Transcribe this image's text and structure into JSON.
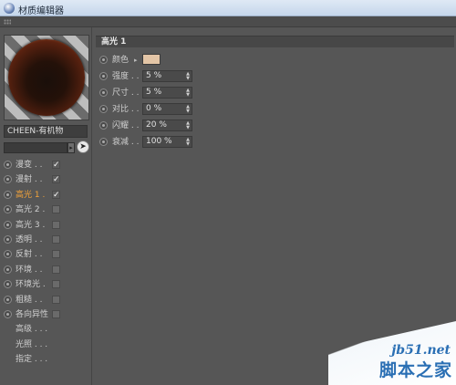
{
  "window": {
    "title": "材质编辑器"
  },
  "material": {
    "name": "CHEEN-有机物",
    "filter_value": ""
  },
  "channels": [
    {
      "label": "漫变 . .",
      "checked": true,
      "active": false
    },
    {
      "label": "漫射 . .",
      "checked": true,
      "active": false
    },
    {
      "label": "高光 1 .",
      "checked": true,
      "active": true
    },
    {
      "label": "高光 2 .",
      "checked": false,
      "active": false
    },
    {
      "label": "高光 3 .",
      "checked": false,
      "active": false
    },
    {
      "label": "透明 . .",
      "checked": false,
      "active": false
    },
    {
      "label": "反射 . .",
      "checked": false,
      "active": false
    },
    {
      "label": "环境 . .",
      "checked": false,
      "active": false
    },
    {
      "label": "环境光 .",
      "checked": false,
      "active": false
    },
    {
      "label": "粗糙 . .",
      "checked": false,
      "active": false
    },
    {
      "label": "各向异性",
      "checked": false,
      "active": false
    }
  ],
  "extra_items": [
    {
      "label": "高级 . . ."
    },
    {
      "label": "光照 . . ."
    },
    {
      "label": "指定 . . ."
    }
  ],
  "properties": {
    "section_title": "高光 1",
    "color": {
      "label": "颜色",
      "value": "#e3c5a6"
    },
    "intensity": {
      "label": "强度 . .",
      "value": "5 %"
    },
    "size": {
      "label": "尺寸 . .",
      "value": "5 %"
    },
    "contrast": {
      "label": "对比 . .",
      "value": "0 %"
    },
    "glare": {
      "label": "闪耀 . .",
      "value": "20 %"
    },
    "falloff": {
      "label": "衰减 . .",
      "value": "100 %"
    }
  },
  "watermark": {
    "site": "jb51.net",
    "name": "脚本之家"
  },
  "colors": {
    "accent_active": "#f2a33a",
    "panel_bg": "#565656"
  }
}
